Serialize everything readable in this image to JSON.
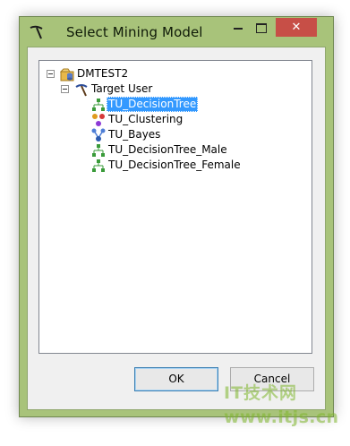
{
  "window": {
    "title": "Select Mining Model",
    "icon": "pickaxe-icon",
    "close_label": "✕"
  },
  "tree": {
    "root": {
      "label": "DMTEST2",
      "icon": "database-folder-icon",
      "expanded": true
    },
    "structure": {
      "label": "Target User",
      "icon": "pickaxe-icon",
      "expanded": true
    },
    "models": [
      {
        "label": "TU_DecisionTree",
        "icon": "decision-tree-icon",
        "selected": true
      },
      {
        "label": "TU_Clustering",
        "icon": "clustering-icon",
        "selected": false
      },
      {
        "label": "TU_Bayes",
        "icon": "bayes-icon",
        "selected": false
      },
      {
        "label": "TU_DecisionTree_Male",
        "icon": "decision-tree-icon",
        "selected": false
      },
      {
        "label": "TU_DecisionTree_Female",
        "icon": "decision-tree-icon",
        "selected": false
      }
    ]
  },
  "buttons": {
    "ok": "OK",
    "cancel": "Cancel"
  },
  "watermark": {
    "brand": "IT技术网",
    "url": "www.itjs.cn"
  },
  "colors": {
    "titlebar": "#a8c37a",
    "selection": "#3399ff",
    "close_button": "#c74f47",
    "watermark": "#7fb62d"
  }
}
